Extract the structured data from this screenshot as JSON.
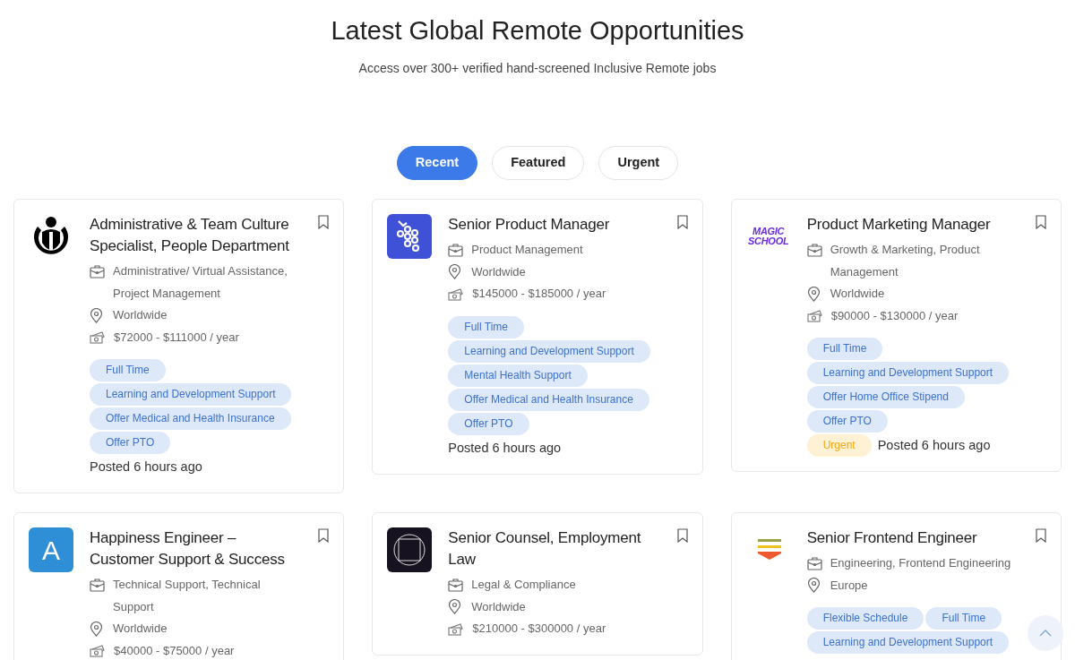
{
  "header": {
    "title": "Latest Global Remote Opportunities",
    "subtitle": "Access over 300+ verified hand-screened Inclusive Remote jobs"
  },
  "tabs": [
    {
      "label": "Recent",
      "selected": true
    },
    {
      "label": "Featured",
      "selected": false
    },
    {
      "label": "Urgent",
      "selected": false
    }
  ],
  "jobs": [
    {
      "logo": {
        "kind": "circle-figure"
      },
      "title": "Administrative & Team Culture Specialist, People Department",
      "category": "Administrative/ Virtual Assistance, Project Management",
      "location": "Worldwide",
      "salary": "$72000 - $111000 / year",
      "tags": [
        "Full Time",
        "Learning and Development Support",
        "Offer Medical and Health Insurance",
        "Offer PTO"
      ],
      "urgent": false,
      "posted": "Posted 6 hours ago"
    },
    {
      "logo": {
        "kind": "grapes"
      },
      "title": "Senior Product Manager",
      "category": "Product Management",
      "location": "Worldwide",
      "salary": "$145000 - $185000 / year",
      "tags": [
        "Full Time",
        "Learning and Development Support",
        "Mental Health Support",
        "Offer Medical and Health Insurance",
        "Offer PTO"
      ],
      "urgent": false,
      "posted": "Posted 6 hours ago"
    },
    {
      "logo": {
        "kind": "wordmark",
        "text": "MAGIC SCHOOL"
      },
      "title": "Product Marketing Manager",
      "category": "Growth & Marketing, Product Management",
      "location": "Worldwide",
      "salary": "$90000 - $130000 / year",
      "tags": [
        "Full Time",
        "Learning and Development Support",
        "Offer Home Office Stipend",
        "Offer PTO"
      ],
      "urgent": true,
      "urgent_label": "Urgent",
      "posted": "Posted 6 hours ago"
    },
    {
      "logo": {
        "kind": "letter",
        "text": "A"
      },
      "title": "Happiness Engineer – Customer Support & Success",
      "category": "Technical Support, Technical Support",
      "location": "Worldwide",
      "salary": "$40000 - $75000 / year"
    },
    {
      "logo": {
        "kind": "framed-square"
      },
      "title": "Senior Counsel, Employment Law",
      "category": "Legal & Compliance",
      "location": "Worldwide",
      "salary": "$210000 - $300000 / year"
    },
    {
      "logo": {
        "kind": "stripes"
      },
      "title": "Senior Frontend Engineer",
      "category": "Engineering, Frontend Engineering",
      "location": "Europe",
      "tags": [
        "Flexible Schedule",
        "Full Time",
        "Learning and Development Support"
      ]
    }
  ]
}
